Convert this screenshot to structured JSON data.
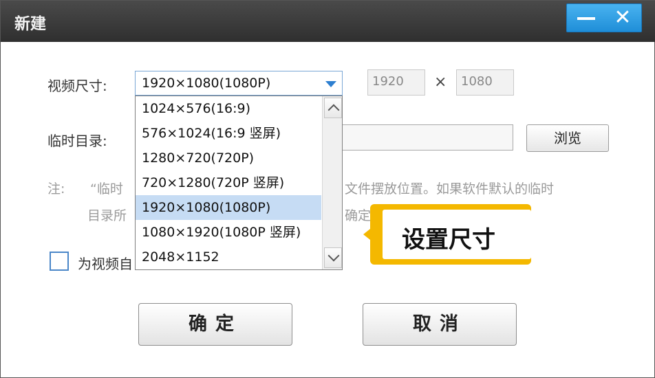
{
  "window": {
    "title": "新建",
    "minimize_glyph": "",
    "close_glyph": "✕"
  },
  "form": {
    "size_label": "视频尺寸:",
    "size_selected": "1920×1080(1080P)",
    "width_value": "1920",
    "times_glyph": "×",
    "height_value": "1080",
    "temp_dir_label": "临时目录:",
    "temp_dir_value": "",
    "browse_label": "浏览",
    "note_prefix": "注:",
    "note_line1_left": "“临时",
    "note_line1_right": "文件摆放位置。如果软件默认的临时",
    "note_line2_left": "目录所",
    "note_line2_right": "确定",
    "checkbox_label": "为视频自"
  },
  "dropdown": {
    "options": [
      "1024×576(16:9)",
      "576×1024(16:9 竖屏)",
      "1280×720(720P)",
      "720×1280(720P 竖屏)",
      "1920×1080(1080P)",
      "1080×1920(1080P 竖屏)",
      "2048×1152"
    ],
    "selected_index": 4
  },
  "buttons": {
    "ok": "确定",
    "cancel": "取消"
  },
  "annotation": {
    "callout_text": "设置尺寸",
    "accent_color": "#f4b800"
  }
}
